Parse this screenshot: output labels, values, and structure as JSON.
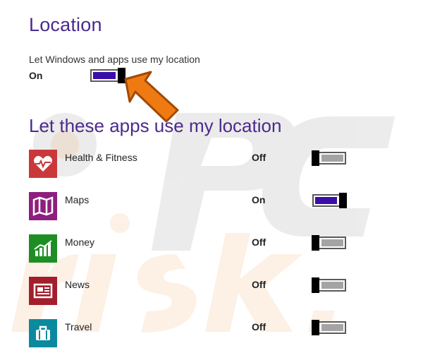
{
  "location": {
    "title": "Location",
    "description": "Let Windows and apps use my location",
    "state_label": "On",
    "enabled": true
  },
  "apps_section": {
    "title": "Let these apps use my location",
    "apps": [
      {
        "name": "Health & Fitness",
        "state_label": "Off",
        "enabled": false,
        "tile_color": "#c9393b",
        "icon": "heart-pulse-icon"
      },
      {
        "name": "Maps",
        "state_label": "On",
        "enabled": true,
        "tile_color": "#8e1f7e",
        "icon": "map-icon"
      },
      {
        "name": "Money",
        "state_label": "Off",
        "enabled": false,
        "tile_color": "#1e8e24",
        "icon": "chart-icon"
      },
      {
        "name": "News",
        "state_label": "Off",
        "enabled": false,
        "tile_color": "#a41d2c",
        "icon": "newspaper-icon"
      },
      {
        "name": "Travel",
        "state_label": "Off",
        "enabled": false,
        "tile_color": "#0b8a9e",
        "icon": "suitcase-icon"
      }
    ]
  },
  "colors": {
    "heading": "#4c2a8e",
    "toggle_on": "#3a0ea8",
    "toggle_off": "#a4a4a4",
    "arrow": "#f07a12"
  },
  "watermark": {
    "text": "PC risk.com"
  }
}
